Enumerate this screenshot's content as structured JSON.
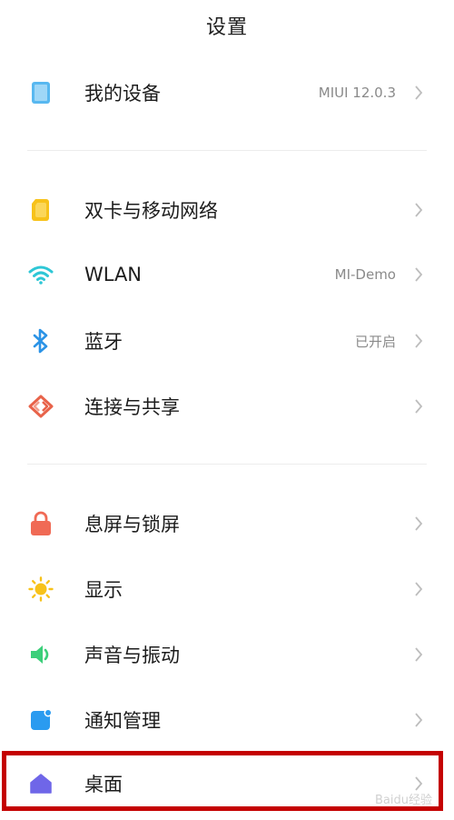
{
  "header": {
    "title": "设置"
  },
  "sections": [
    {
      "items": [
        {
          "label": "我的设备",
          "value": "MIUI 12.0.3",
          "icon": "device-icon"
        }
      ]
    },
    {
      "items": [
        {
          "label": "双卡与移动网络",
          "value": "",
          "icon": "sim-card-icon"
        },
        {
          "label": "WLAN",
          "value": "MI-Demo",
          "icon": "wifi-icon"
        },
        {
          "label": "蓝牙",
          "value": "已开启",
          "icon": "bluetooth-icon"
        },
        {
          "label": "连接与共享",
          "value": "",
          "icon": "connection-share-icon"
        }
      ]
    },
    {
      "items": [
        {
          "label": "息屏与锁屏",
          "value": "",
          "icon": "lock-icon"
        },
        {
          "label": "显示",
          "value": "",
          "icon": "sun-icon"
        },
        {
          "label": "声音与振动",
          "value": "",
          "icon": "speaker-icon"
        },
        {
          "label": "通知管理",
          "value": "",
          "icon": "notification-icon"
        },
        {
          "label": "桌面",
          "value": "",
          "icon": "home-icon"
        }
      ]
    }
  ],
  "colors": {
    "device_icon": "#58b8f0",
    "sim_icon": "#f7c21a",
    "wifi_icon": "#2ec7d6",
    "bluetooth_icon": "#2b93e6",
    "connection_icon": "#e8634a",
    "lock_icon": "#f06a55",
    "sun_icon": "#f7c21a",
    "speaker_icon": "#3ccf7a",
    "notification_icon": "#2a9bf0",
    "home_icon": "#6f66e8",
    "highlight": "#c40000"
  },
  "watermark": "Baidu经验"
}
